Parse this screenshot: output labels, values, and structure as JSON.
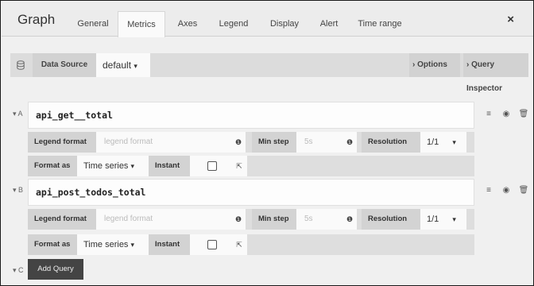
{
  "panel": {
    "title": "Graph",
    "close_label": "×"
  },
  "tabs": [
    {
      "label": "General"
    },
    {
      "label": "Metrics"
    },
    {
      "label": "Axes"
    },
    {
      "label": "Legend"
    },
    {
      "label": "Display"
    },
    {
      "label": "Alert"
    },
    {
      "label": "Time range"
    }
  ],
  "datasource": {
    "label": "Data Source",
    "value": "default",
    "options_label": "Options",
    "inspector_label": "Query Inspector"
  },
  "queries": [
    {
      "letter": "A",
      "expr": "api_get__total",
      "legend_format_label": "Legend format",
      "legend_format_placeholder": "legend format",
      "min_step_label": "Min step",
      "min_step_placeholder": "5s",
      "resolution_label": "Resolution",
      "resolution_value": "1/1",
      "format_as_label": "Format as",
      "format_as_value": "Time series",
      "instant_label": "Instant"
    },
    {
      "letter": "B",
      "expr": "api_post_todos_total",
      "legend_format_label": "Legend format",
      "legend_format_placeholder": "legend format",
      "min_step_label": "Min step",
      "min_step_placeholder": "5s",
      "resolution_label": "Resolution",
      "resolution_value": "1/1",
      "format_as_label": "Format as",
      "format_as_value": "Time series",
      "instant_label": "Instant"
    }
  ],
  "add_query": {
    "letter": "C",
    "label": "Add Query"
  },
  "icons": {
    "caret": "▾",
    "chevron": "›",
    "info": "❶",
    "menu": "≡",
    "eye": "◉",
    "trash": "🗑",
    "link": "⇱"
  }
}
